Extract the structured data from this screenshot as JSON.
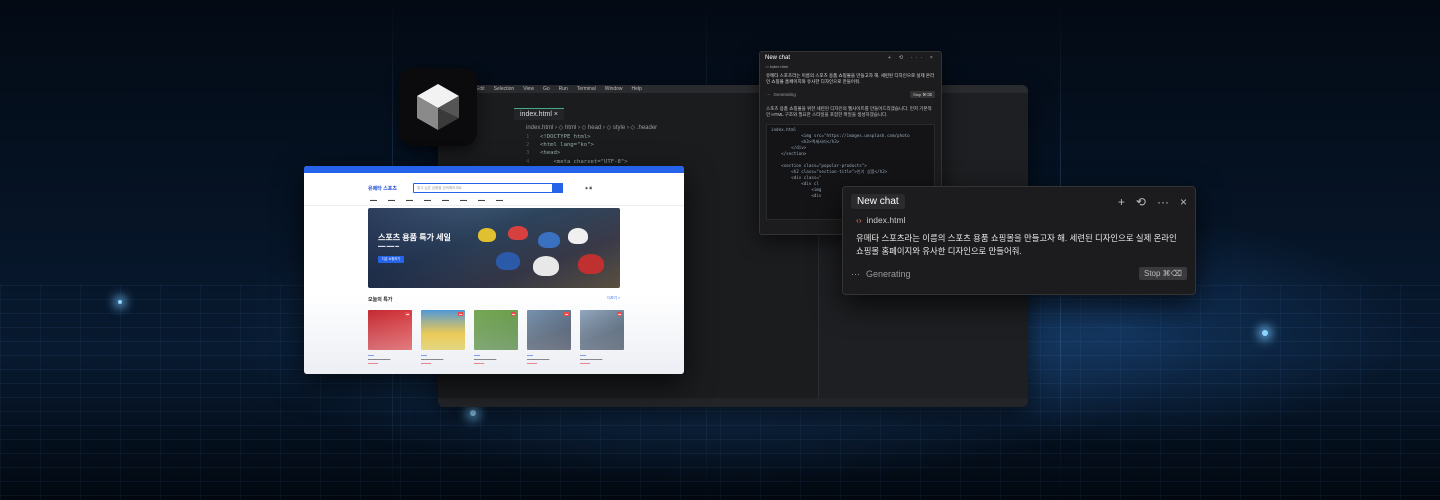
{
  "editor": {
    "menu": [
      "Edit",
      "Selection",
      "View",
      "Go",
      "Run",
      "Terminal",
      "Window",
      "Help"
    ],
    "tab_label": "index.html",
    "breadcrumbs": "index.html › ◇ html › ◇ head › ◇ style › ◇ .header",
    "code_lines": [
      {
        "n": "1",
        "t": "<!DOCTYPE html>"
      },
      {
        "n": "2",
        "t": "<html lang=\"ko\">"
      },
      {
        "n": "3",
        "t": "<head>"
      },
      {
        "n": "4",
        "t": "    <meta charset=\"UTF-8\">"
      }
    ]
  },
  "browser": {
    "logo": "유메타 스포츠",
    "search_placeholder": "찾고 싶은 상품을 검색해보세요",
    "hero_title": "스포츠 용품 특가 세일",
    "hero_button": "지금 쇼핑하기",
    "section_title": "오늘의 특가",
    "more": "더보기 >"
  },
  "chat_small": {
    "title": "New chat",
    "file": "index.html",
    "prompt": "유메타 스포츠라는 이름의 스포츠 용품 쇼핑몰을 만들고자 해. 세련된 디자인으로 실제 온라인 쇼핑몰 홈페이지와 유사한 디자인으로 만들어줘.",
    "status": "Generating",
    "stop": "Stop ⌘⌫",
    "answer": "스포츠 용품 쇼핑몰을 위한 세련된 디자인의 웹사이트를 만들어드리겠습니다. 먼저 기본적인 HTML 구조와 필요한 스타일을 포함한 파일을 생성하겠습니다.",
    "code_file": "index.html",
    "code_lines": [
      "            <img src=\"https://images.unsplash.com/photo",
      "            <h3>액세서리</h3>",
      "        </div>",
      "    </section>",
      "",
      "    <section class=\"popular-products\">",
      "        <h2 class=\"section-title\">인기 상품</h2>",
      "        <div class=\"",
      "            <div cl",
      "                <img",
      "                <div"
    ]
  },
  "chat_large": {
    "title": "New chat",
    "file": "index.html",
    "prompt": "유메타 스포츠라는 이름의 스포츠 용품 쇼핑몰을 만들고자 해. 세련된 디자인으로 실제 온라인 쇼핑몰 홈페이지와 유사한 디자인으로 만들어줘.",
    "status": "Generating",
    "stop": "Stop ⌘⌫"
  }
}
